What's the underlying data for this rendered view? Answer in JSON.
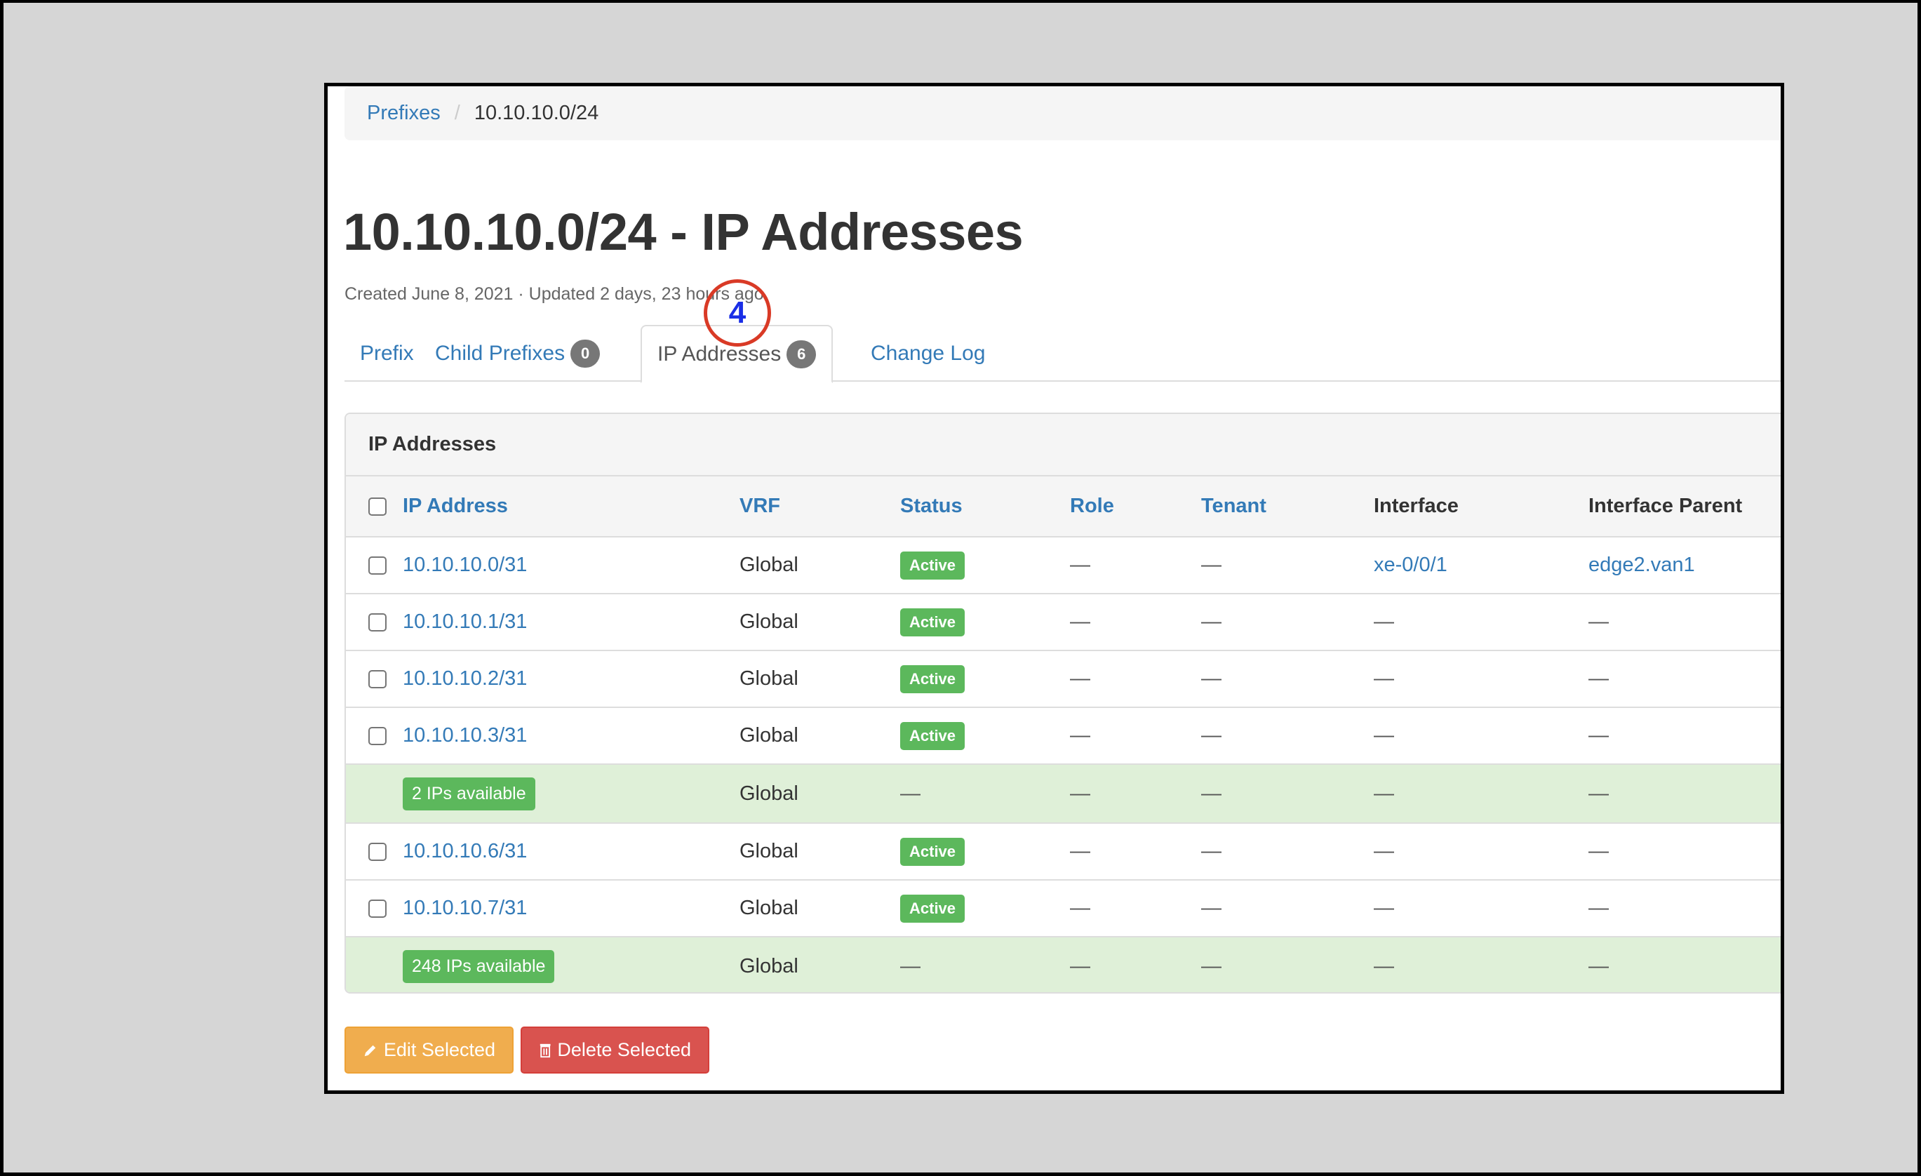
{
  "breadcrumb": {
    "items": [
      {
        "label": "Prefixes",
        "link": true
      },
      {
        "label": "10.10.10.0/24",
        "link": false
      }
    ],
    "separator": "/"
  },
  "page": {
    "title": "10.10.10.0/24 - IP Addresses",
    "meta": "Created June 8, 2021 · Updated 2 days, 23 hours ago"
  },
  "tabs": [
    {
      "label": "Prefix",
      "count": null,
      "active": false
    },
    {
      "label": "Child Prefixes",
      "count": "0",
      "active": false
    },
    {
      "label": "IP Addresses",
      "count": "6",
      "active": true
    },
    {
      "label": "Change Log",
      "count": null,
      "active": false
    }
  ],
  "panel": {
    "heading": "IP Addresses",
    "columns": [
      "IP Address",
      "VRF",
      "Status",
      "Role",
      "Tenant",
      "Interface",
      "Interface Parent"
    ],
    "rows": [
      {
        "type": "ip",
        "ip": "10.10.10.0/31",
        "vrf": "Global",
        "status": "Active",
        "role": "—",
        "tenant": "—",
        "interface": "xe-0/0/1",
        "parent": "edge2.van1"
      },
      {
        "type": "ip",
        "ip": "10.10.10.1/31",
        "vrf": "Global",
        "status": "Active",
        "role": "—",
        "tenant": "—",
        "interface": "—",
        "parent": "—"
      },
      {
        "type": "ip",
        "ip": "10.10.10.2/31",
        "vrf": "Global",
        "status": "Active",
        "role": "—",
        "tenant": "—",
        "interface": "—",
        "parent": "—"
      },
      {
        "type": "ip",
        "ip": "10.10.10.3/31",
        "vrf": "Global",
        "status": "Active",
        "role": "—",
        "tenant": "—",
        "interface": "—",
        "parent": "—"
      },
      {
        "type": "available",
        "ip": "2 IPs available",
        "vrf": "Global",
        "status": "—",
        "role": "—",
        "tenant": "—",
        "interface": "—",
        "parent": "—"
      },
      {
        "type": "ip",
        "ip": "10.10.10.6/31",
        "vrf": "Global",
        "status": "Active",
        "role": "—",
        "tenant": "—",
        "interface": "—",
        "parent": "—"
      },
      {
        "type": "ip",
        "ip": "10.10.10.7/31",
        "vrf": "Global",
        "status": "Active",
        "role": "—",
        "tenant": "—",
        "interface": "—",
        "parent": "—"
      },
      {
        "type": "available",
        "ip": "248 IPs available",
        "vrf": "Global",
        "status": "—",
        "role": "—",
        "tenant": "—",
        "interface": "—",
        "parent": "—"
      }
    ]
  },
  "actions": {
    "edit_label": "Edit Selected",
    "delete_label": "Delete Selected"
  },
  "annotation": {
    "label": "4"
  },
  "colors": {
    "link": "#337ab7",
    "success": "#5cb85c",
    "available_row": "#dff0d8",
    "warning": "#f0ad4e",
    "danger": "#d9534f",
    "annotation_ring": "#d93a26",
    "annotation_text": "#1a2ee6"
  }
}
